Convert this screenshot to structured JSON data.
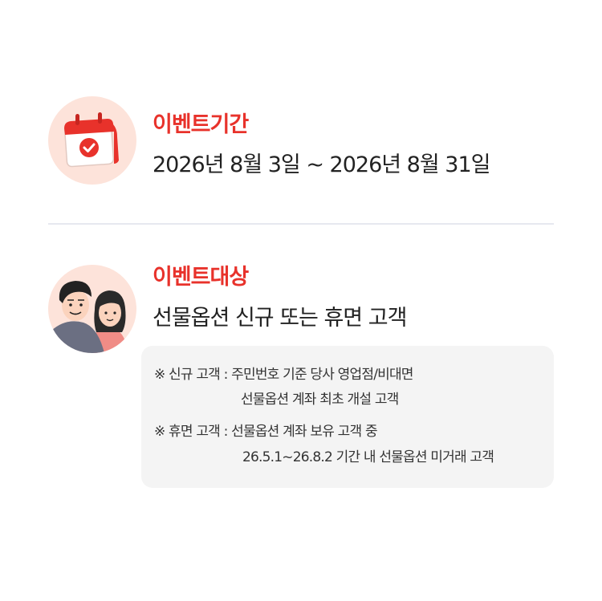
{
  "period": {
    "label": "이벤트기간",
    "value": "2026년 8월 3일 ~ 2026년 8월 31일",
    "icon": "calendar-check-icon"
  },
  "target": {
    "label": "이벤트대상",
    "value": "선물옵션 신규 또는 휴면 고객",
    "icon": "couple-icon"
  },
  "notes": {
    "new_line1": "※ 신규 고객 : 주민번호 기준 당사 영업점/비대면",
    "new_line2": "선물옵션 계좌 최초 개설 고객",
    "dormant_line1": "※ 휴면 고객 : 선물옵션 계좌 보유 고객 중",
    "dormant_line2": "26.5.1~26.8.2 기간 내 선물옵션 미거래 고객"
  },
  "colors": {
    "accent": "#e8322b",
    "icon_bg": "#fde3da",
    "divider": "#e6e8f0",
    "note_bg": "#f4f4f4"
  }
}
